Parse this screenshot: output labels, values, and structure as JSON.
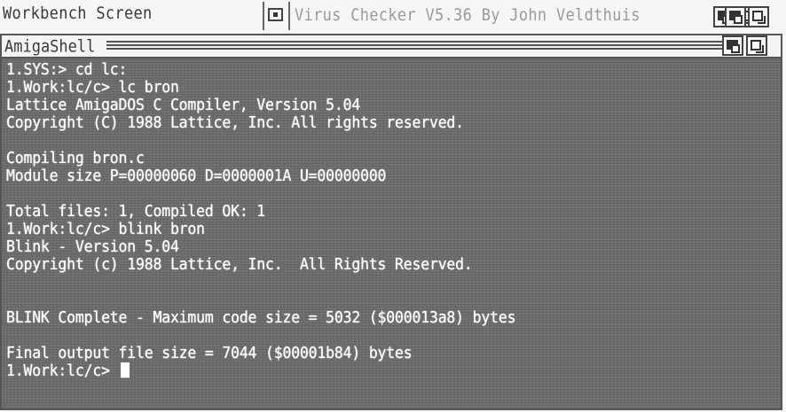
{
  "workbench": {
    "screen_title": "Workbench Screen"
  },
  "virus_checker": {
    "window_title": "Virus Checker V5.36 By John Veldthuis"
  },
  "shell": {
    "window_title": "AmigaShell",
    "console_lines": [
      "1.SYS:> cd lc:",
      "1.Work:lc/c> lc bron",
      "Lattice AmigaDOS C Compiler, Version 5.04",
      "Copyright (C) 1988 Lattice, Inc. All rights reserved.",
      "",
      "Compiling bron.c",
      "Module size P=00000060 D=0000001A U=00000000",
      "",
      "Total files: 1, Compiled OK: 1",
      "1.Work:lc/c> blink bron",
      "Blink - Version 5.04",
      "Copyright (c) 1988 Lattice, Inc.  All Rights Reserved.",
      "",
      "",
      "BLINK Complete - Maximum code size = 5032 ($000013a8) bytes",
      "",
      "Final output file size = 7044 ($00001b84) bytes"
    ],
    "prompt": "1.Work:lc/c>"
  }
}
